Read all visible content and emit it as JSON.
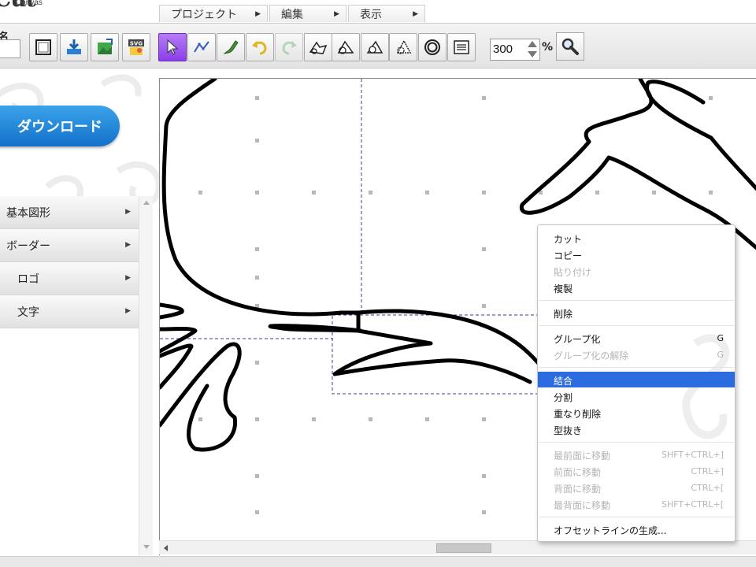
{
  "app": {
    "logo_text": "Cut",
    "logo_sub": "Canvas"
  },
  "menu": [
    {
      "label": "プロジェクト"
    },
    {
      "label": "編集"
    },
    {
      "label": "表示"
    }
  ],
  "toolbar": {
    "name_label": "名",
    "name_value": "",
    "zoom_value": "300",
    "zoom_unit": "%",
    "svg_badge": "SVG"
  },
  "sidebar": {
    "download_label": "ダウンロード",
    "categories": [
      {
        "label": "基本図形"
      },
      {
        "label": "ボーダー"
      },
      {
        "label": "ロゴ"
      },
      {
        "label": "文字"
      }
    ]
  },
  "context_menu": {
    "items": [
      {
        "label": "カット",
        "shortcut": "",
        "disabled": false
      },
      {
        "label": "コピー",
        "shortcut": "",
        "disabled": false
      },
      {
        "label": "貼り付け",
        "shortcut": "",
        "disabled": true
      },
      {
        "label": "複製",
        "shortcut": "",
        "disabled": false
      },
      {
        "label": "削除",
        "shortcut": "",
        "disabled": false
      },
      {
        "label": "グループ化",
        "shortcut": "G",
        "disabled": false
      },
      {
        "label": "グループ化の解除",
        "shortcut": "G",
        "disabled": true
      },
      {
        "label": "結合",
        "shortcut": "",
        "disabled": false,
        "highlighted": true
      },
      {
        "label": "分割",
        "shortcut": "",
        "disabled": false
      },
      {
        "label": "重なり削除",
        "shortcut": "",
        "disabled": false
      },
      {
        "label": "型抜き",
        "shortcut": "",
        "disabled": false
      },
      {
        "label": "最前面に移動",
        "shortcut": "SHFT+CTRL+]",
        "disabled": true
      },
      {
        "label": "前面に移動",
        "shortcut": "CTRL+]",
        "disabled": true
      },
      {
        "label": "背面に移動",
        "shortcut": "CTRL+[",
        "disabled": true
      },
      {
        "label": "最背面に移動",
        "shortcut": "SHFT+CTRL+[",
        "disabled": true
      },
      {
        "label": "オフセットラインの生成...",
        "shortcut": "",
        "disabled": false
      }
    ]
  },
  "colors": {
    "accent": "#2d6be0",
    "download": "#1470c9",
    "active_tool": "#8a3ee8"
  }
}
